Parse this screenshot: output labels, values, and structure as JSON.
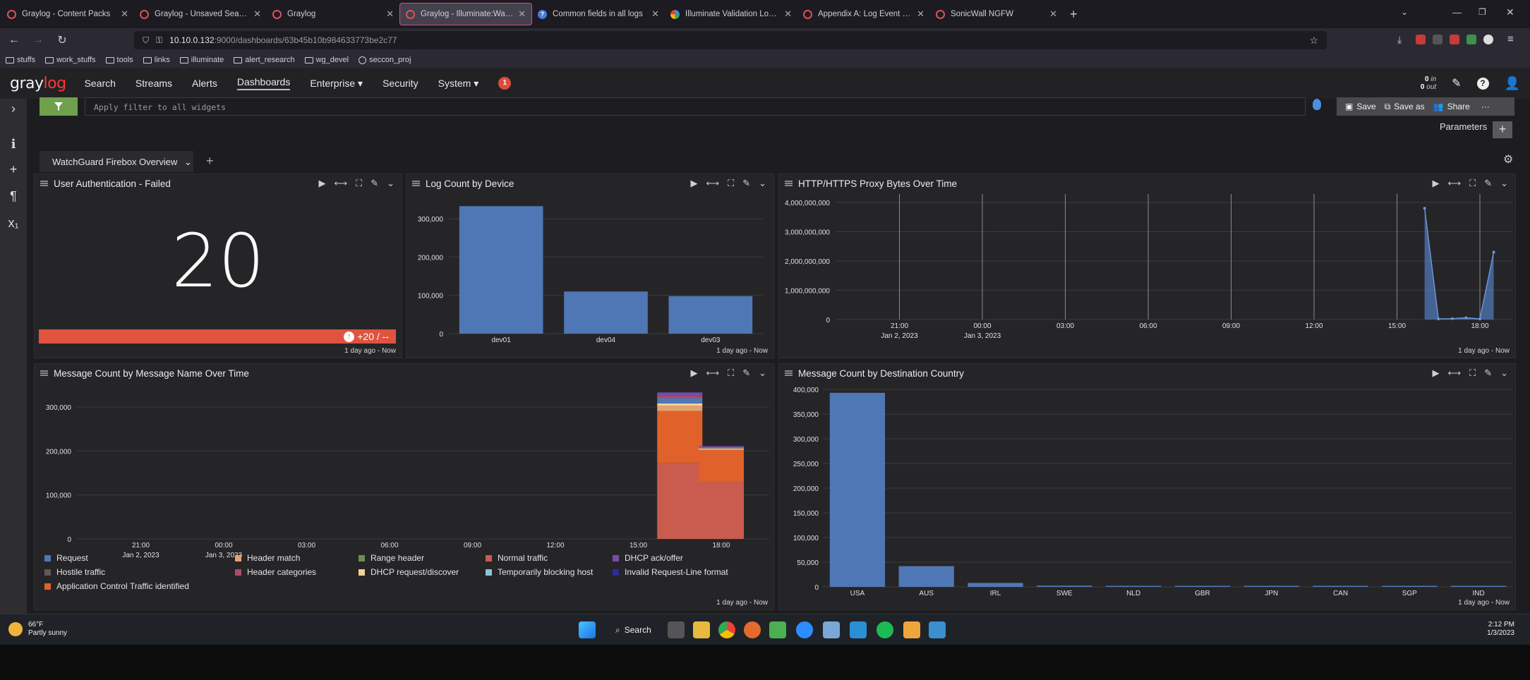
{
  "browser": {
    "tabs": [
      {
        "title": "Graylog - Content Packs",
        "icon": "graylog-icon"
      },
      {
        "title": "Graylog - Unsaved Search",
        "icon": "graylog-icon"
      },
      {
        "title": "Graylog",
        "icon": "graylog-icon"
      },
      {
        "title": "Graylog - Illuminate:WatchGuard",
        "icon": "graylog-icon"
      },
      {
        "title": "Common fields in all logs",
        "icon": "help-icon"
      },
      {
        "title": "Illuminate Validation Logs - Go",
        "icon": "google-drive-icon"
      },
      {
        "title": "Appendix A: Log Event Catalog",
        "icon": "graylog-icon"
      },
      {
        "title": "SonicWall NGFW",
        "icon": "graylog-icon"
      }
    ],
    "url_host": "10.10.0.132",
    "url_path": ":9000/dashboards/63b45b10b984633773be2c77",
    "bookmarks": [
      "stuffs",
      "work_stuffs",
      "tools",
      "links",
      "illuminate",
      "alert_research",
      "wg_devel",
      "seccon_proj"
    ]
  },
  "graylog": {
    "logo_a": "gray",
    "logo_b": "log",
    "nav": [
      "Search",
      "Streams",
      "Alerts",
      "Dashboards",
      "Enterprise ▾",
      "Security",
      "System ▾"
    ],
    "notification_count": "1",
    "throughput_in": "0",
    "throughput_in_label": "in",
    "throughput_out": "0",
    "throughput_out_label": "out"
  },
  "dashboard": {
    "filter_placeholder": "Apply filter to all widgets",
    "save": "Save",
    "save_as": "Save as",
    "share": "Share",
    "parameters": "Parameters",
    "tab": "WatchGuard Firebox Overview"
  },
  "widgets": {
    "auth_failed": {
      "title": "User Authentication - Failed",
      "value": "20",
      "trend": "+20 / --",
      "footer": "1 day ago - Now"
    },
    "log_count": {
      "title": "Log Count by Device",
      "footer": "1 day ago - Now"
    },
    "proxy_bytes": {
      "title": "HTTP/HTTPS Proxy Bytes Over Time",
      "footer": "1 day ago - Now"
    },
    "msg_name": {
      "title": "Message Count by Message Name Over Time",
      "footer": "1 day ago - Now"
    },
    "msg_country": {
      "title": "Message Count by Destination Country",
      "footer": "1 day ago - Now"
    }
  },
  "chart_data": [
    {
      "type": "bar",
      "categories": [
        "dev01",
        "dev04",
        "dev03"
      ],
      "values": [
        333000,
        110000,
        98000
      ],
      "yticks": [
        "0",
        "100,000",
        "200,000",
        "300,000"
      ],
      "ylim": [
        0,
        350000
      ],
      "color": "#5077b5"
    },
    {
      "type": "area",
      "xticks": [
        "21:00",
        "00:00",
        "03:00",
        "06:00",
        "09:00",
        "12:00",
        "15:00",
        "18:00"
      ],
      "xsublabels": [
        "Jan 2, 2023",
        "Jan 3, 2023"
      ],
      "yticks": [
        "0",
        "1,000,000,000",
        "2,000,000,000",
        "3,000,000,000",
        "4,000,000,000"
      ],
      "ylim": [
        0,
        4000000000
      ],
      "x_hours": [
        16.0,
        16.5,
        17.0,
        17.5,
        18.0,
        18.5
      ],
      "values": [
        3800000000,
        20000000,
        30000000,
        60000000,
        20000000,
        2300000000
      ],
      "color": "#5077b5"
    },
    {
      "type": "bar",
      "stacked": true,
      "xticks": [
        "21:00",
        "00:00",
        "03:00",
        "06:00",
        "09:00",
        "12:00",
        "15:00",
        "18:00"
      ],
      "xsublabels": [
        "Jan 2, 2023",
        "Jan 3, 2023"
      ],
      "yticks": [
        "0",
        "100,000",
        "200,000",
        "300,000"
      ],
      "ylim": [
        0,
        340000
      ],
      "bars": [
        {
          "x_hour": 16.5,
          "segments": [
            {
              "series": "Normal traffic",
              "value": 173000
            },
            {
              "series": "Application Control Traffic identified",
              "value": 118000
            },
            {
              "series": "Header match",
              "value": 12000
            },
            {
              "series": "DHCP request/discover",
              "value": 5000
            },
            {
              "series": "Request",
              "value": 12000
            },
            {
              "series": "Header categories",
              "value": 5000
            },
            {
              "series": "DHCP ack/offer",
              "value": 8000
            }
          ]
        },
        {
          "x_hour": 18.0,
          "segments": [
            {
              "series": "Normal traffic",
              "value": 130000
            },
            {
              "series": "Application Control Traffic identified",
              "value": 72000
            },
            {
              "series": "Header match",
              "value": 4000
            },
            {
              "series": "Request",
              "value": 3000
            },
            {
              "series": "DHCP ack/offer",
              "value": 2000
            }
          ]
        }
      ],
      "legend": [
        {
          "name": "Request",
          "color": "#5077b5"
        },
        {
          "name": "Header match",
          "color": "#e3a26d"
        },
        {
          "name": "Range header",
          "color": "#6a8f4e"
        },
        {
          "name": "Normal traffic",
          "color": "#c95c4e"
        },
        {
          "name": "DHCP ack/offer",
          "color": "#7a4aa8"
        },
        {
          "name": "Hostile traffic",
          "color": "#5a5a5a"
        },
        {
          "name": "Header categories",
          "color": "#b04a6a"
        },
        {
          "name": "DHCP request/discover",
          "color": "#f2d29a"
        },
        {
          "name": "Temporarily blocking host",
          "color": "#8fc3d4"
        },
        {
          "name": "Invalid Request-Line format",
          "color": "#2c2c9a"
        },
        {
          "name": "Application Control Traffic identified",
          "color": "#e0622a"
        }
      ]
    },
    {
      "type": "bar",
      "categories": [
        "USA",
        "AUS",
        "IRL",
        "SWE",
        "NLD",
        "GBR",
        "JPN",
        "CAN",
        "SGP",
        "IND"
      ],
      "values": [
        393000,
        42000,
        8000,
        2500,
        2000,
        1500,
        1000,
        800,
        600,
        400
      ],
      "yticks": [
        "0",
        "50,000",
        "100,000",
        "150,000",
        "200,000",
        "250,000",
        "300,000",
        "350,000",
        "400,000"
      ],
      "ylim": [
        0,
        400000
      ],
      "color": "#5077b5"
    }
  ],
  "taskbar": {
    "temp": "66°F",
    "weather": "Partly sunny",
    "search": "Search",
    "time": "2:12 PM",
    "date": "1/3/2023"
  }
}
